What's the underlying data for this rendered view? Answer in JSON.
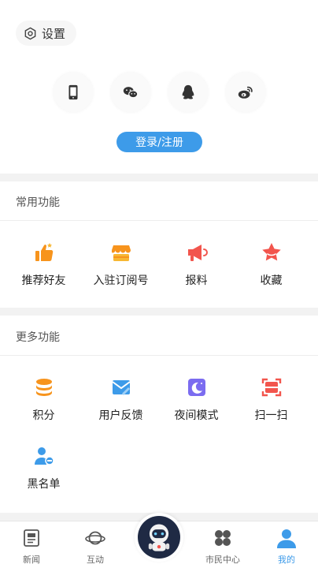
{
  "header": {
    "settings_label": "设置"
  },
  "login": {
    "icons": [
      "phone-icon",
      "wechat-icon",
      "qq-icon",
      "weibo-icon"
    ],
    "button_label": "登录/注册"
  },
  "common": {
    "title": "常用功能",
    "items": [
      {
        "label": "推荐好友",
        "icon": "thumbs-up-icon",
        "color": "#f7941d"
      },
      {
        "label": "入驻订阅号",
        "icon": "shop-icon",
        "color": "#f7941d"
      },
      {
        "label": "报料",
        "icon": "megaphone-icon",
        "color": "#f2554d"
      },
      {
        "label": "收藏",
        "icon": "star-icon",
        "color": "#f2554d"
      }
    ]
  },
  "more": {
    "title": "更多功能",
    "items": [
      {
        "label": "积分",
        "icon": "coins-icon",
        "color": "#f7941d"
      },
      {
        "label": "用户反馈",
        "icon": "feedback-mail-icon",
        "color": "#3d9be9"
      },
      {
        "label": "夜间模式",
        "icon": "moon-icon",
        "color": "#7b6cf0"
      },
      {
        "label": "扫一扫",
        "icon": "scan-icon",
        "color": "#f2554d"
      },
      {
        "label": "黑名单",
        "icon": "blacklist-user-icon",
        "color": "#3d9be9"
      }
    ]
  },
  "tabbar": {
    "tabs": [
      {
        "label": "新闻",
        "icon": "news-icon"
      },
      {
        "label": "互动",
        "icon": "planet-icon"
      },
      {
        "label": "市民中心",
        "icon": "clover-icon"
      },
      {
        "label": "我的",
        "icon": "user-icon",
        "active": true
      }
    ],
    "center_icon": "astronaut-icon"
  }
}
